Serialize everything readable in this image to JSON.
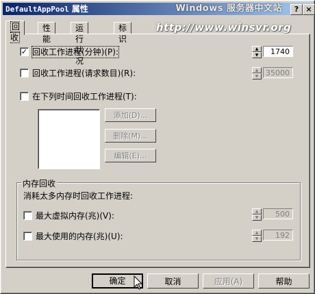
{
  "window": {
    "title_prefix": "DefaultAppPool",
    "title_suffix": " 属性",
    "watermark_top": "Windows 服务器中文站",
    "watermark_url": "http://www.winsvr.org",
    "help_btn": "?",
    "close_btn": "×",
    "gradient_start": "#0a246a",
    "gradient_end": "#a6caf0"
  },
  "tabs": [
    "回收",
    "性能",
    "运行状况",
    "标识"
  ],
  "recycle": {
    "minutes": {
      "label": "回收工作进程(分钟)(P):",
      "checked": true,
      "value": "1740"
    },
    "requests": {
      "label": "回收工作进程(请求数目)(R):",
      "checked": false,
      "value": "35000"
    },
    "times": {
      "label": "在下列时间回收工作进程(T):",
      "checked": false
    }
  },
  "time_buttons": {
    "add": "添加(D)...",
    "remove": "删除(M)...",
    "edit": "编辑(E)..."
  },
  "memory": {
    "group_title": "内存回收",
    "description": "消耗太多内存时回收工作进程:",
    "virtual": {
      "label": "最大虚拟内存(兆)(V):",
      "checked": false,
      "value": "500"
    },
    "used": {
      "label": "最大使用的内存(兆)(U):",
      "checked": false,
      "value": "192"
    }
  },
  "buttons": {
    "ok": "确定",
    "cancel": "取消",
    "apply": "应用(A)",
    "help": "帮助"
  },
  "check_mark": "✓",
  "arrow_up": "▲",
  "arrow_down": "▼"
}
